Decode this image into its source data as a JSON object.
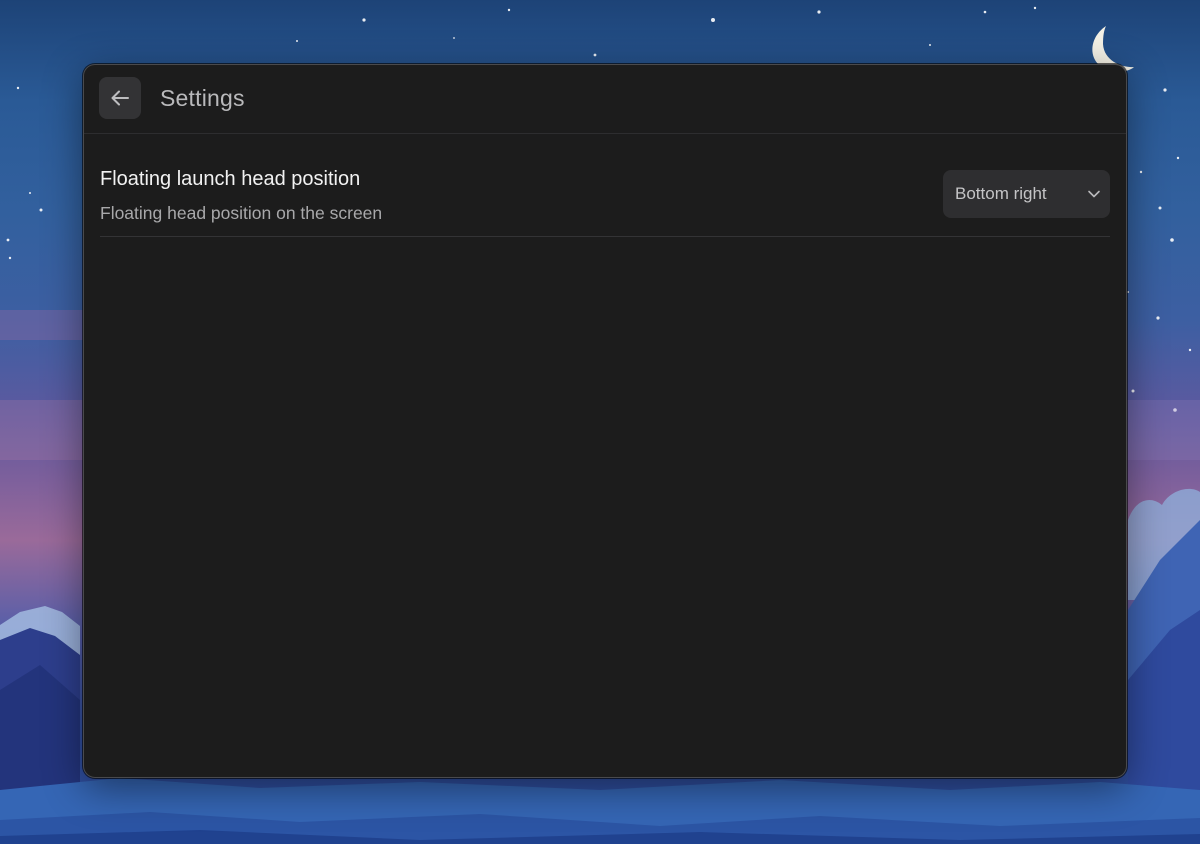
{
  "header": {
    "title": "Settings",
    "back_icon": "arrow-left-icon"
  },
  "settings": [
    {
      "title": "Floating launch head position",
      "description": "Floating head position on the screen",
      "control": {
        "type": "select",
        "selected": "Bottom right",
        "icon": "chevron-down-icon"
      }
    }
  ],
  "colors": {
    "window_bg": "#1c1c1c",
    "control_bg": "#2e2e30",
    "title_text": "#f2f2f2",
    "secondary_text": "#a8a8aa"
  }
}
